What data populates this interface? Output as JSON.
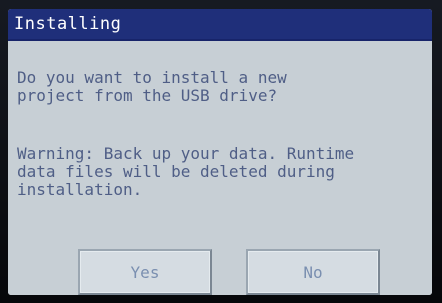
{
  "dialog": {
    "title": "Installing",
    "question_lines": [
      "Do you want to install a new",
      "project from the USB drive?"
    ],
    "warning_lines": [
      "Warning: Back up your data. Runtime",
      "data files will be deleted during",
      "installation."
    ],
    "buttons": {
      "yes": "Yes",
      "no": "No"
    }
  },
  "colors": {
    "titlebar": "#1f2f7a",
    "content_background": "#c7cfd5",
    "text": "#4f5e86"
  }
}
